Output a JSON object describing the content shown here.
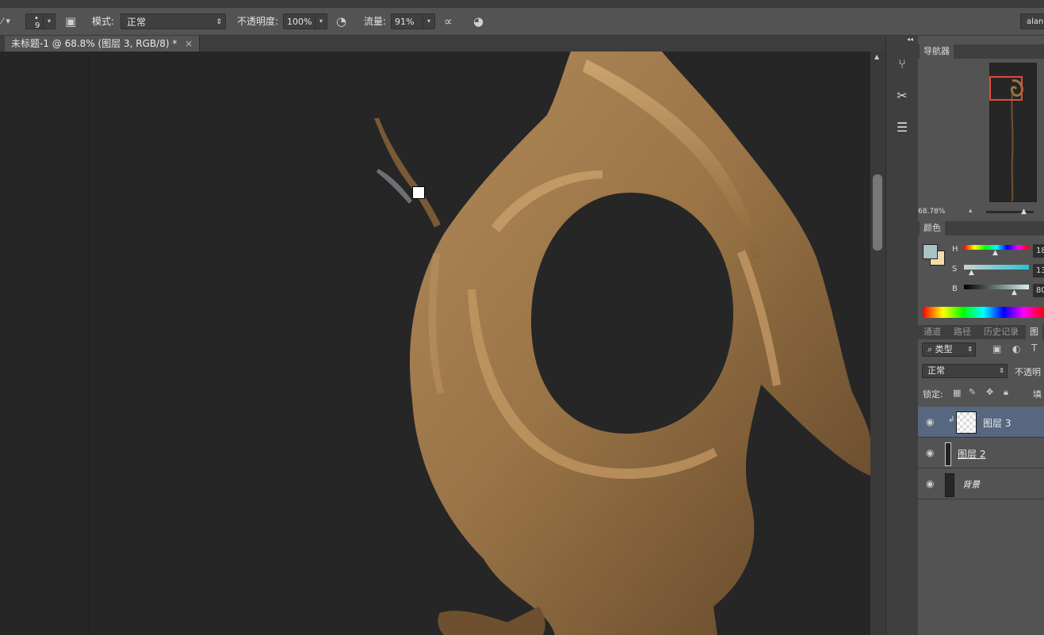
{
  "options_bar": {
    "brush_size": "9",
    "mode_label": "模式:",
    "mode_value": "正常",
    "opacity_label": "不透明度:",
    "opacity_value": "100%",
    "flow_label": "流量:",
    "flow_value": "91%",
    "user": "alan"
  },
  "document": {
    "tab_title": "未标题-1 @ 68.8% (图层 3, RGB/8) *",
    "close": "×"
  },
  "panels": {
    "navigator_tab": "导航器",
    "zoom": "68.78%",
    "color_tab": "颜色",
    "h_label": "H",
    "s_label": "S",
    "b_label": "B",
    "h_value": "18",
    "s_value": "13",
    "b_value": "80",
    "foreground_color": "#a9c3c7",
    "background_color": "#f3dcaa",
    "tabs": [
      "通道",
      "路径",
      "历史记录",
      "图"
    ],
    "filter_kind": "类型",
    "blend_mode": "正常",
    "opacity_label": "不透明",
    "lock_label": "锁定:",
    "fill_label": "填",
    "layers": [
      {
        "name": "图层 3",
        "selected": true
      },
      {
        "name": "图层 2",
        "selected": false
      },
      {
        "name": "背景",
        "selected": false
      }
    ]
  },
  "icons": {
    "brush_preset": "brush-preset-icon",
    "toggle_brush_panel": "brush-panel-icon",
    "pressure_opacity": "pen-pressure-icon",
    "airbrush": "airbrush-icon",
    "pressure_size": "pen-pressure-size-icon",
    "eye": "eye-icon",
    "lock": "lock-icon"
  }
}
